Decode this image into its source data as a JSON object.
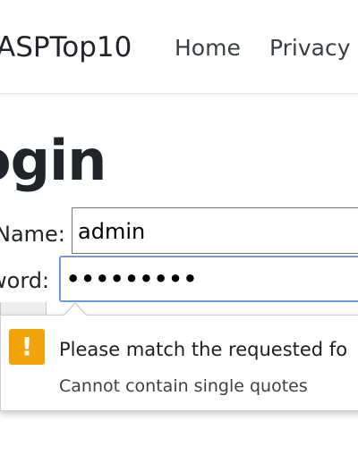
{
  "navbar": {
    "brand": "ASPTop10",
    "links": [
      "Home",
      "Privacy"
    ]
  },
  "page": {
    "title": "ogin"
  },
  "form": {
    "name_label": "Name:",
    "name_value": "admin",
    "password_label": "word:",
    "password_value": "•••••••••"
  },
  "validation": {
    "icon": "warning-icon",
    "icon_glyph": "!",
    "icon_color": "#f0a30a",
    "message": "Please match the requested fo",
    "detail": "Cannot contain single quotes"
  }
}
